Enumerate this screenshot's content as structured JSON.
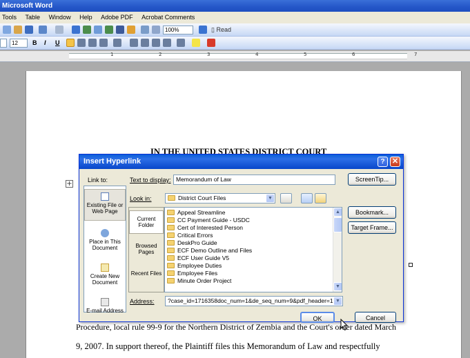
{
  "app": {
    "title": "Microsoft Word"
  },
  "menu": [
    "Tools",
    "Table",
    "Window",
    "Help",
    "Adobe PDF",
    "Acrobat Comments"
  ],
  "toolbar": {
    "zoom": "100%",
    "read_label": "Read",
    "font_size": "12",
    "bold": "B",
    "italic": "I",
    "underline": "U"
  },
  "ruler": {
    "numbers": [
      "1",
      "2",
      "3",
      "4",
      "5",
      "6",
      "7"
    ]
  },
  "document": {
    "heading": "IN THE UNITED STATES DISTRICT COURT",
    "line1": "Procedure, local rule 99-9 for the Northern District of Zembia and the Court's order dated March",
    "line2": "9, 2007. In support thereof, the Plaintiff files this Memorandum of Law and respectfully"
  },
  "dialog": {
    "title": "Insert Hyperlink",
    "link_to_label": "Link to:",
    "text_to_display_label": "Text to display:",
    "text_to_display_value": "Memorandum of Law",
    "screentip_label": "ScreenTip...",
    "look_in_label": "Look in:",
    "look_in_value": "District Court Files",
    "bookmark_label": "Bookmark...",
    "target_frame_label": "Target Frame...",
    "address_label": "Address:",
    "address_value": "?case_id=1716358doc_num=1&de_seq_num=9&pdf_header=1",
    "ok_label": "OK",
    "cancel_label": "Cancel",
    "link_to_items": [
      {
        "label": "Existing File or Web Page"
      },
      {
        "label": "Place in This Document"
      },
      {
        "label": "Create New Document"
      },
      {
        "label": "E-mail Address"
      }
    ],
    "places": [
      {
        "label": "Current Folder"
      },
      {
        "label": "Browsed Pages"
      },
      {
        "label": "Recent Files"
      }
    ],
    "files": [
      "Appeal Streamline",
      "CC Payment Guide - USDC",
      "Cert of Interested Person",
      "Critical Errors",
      "DeskPro Guide",
      "ECF Demo Outline and Files",
      "ECF User Guide V5",
      "Employee Duties",
      "Employee Files",
      "Minute Order Project"
    ]
  }
}
